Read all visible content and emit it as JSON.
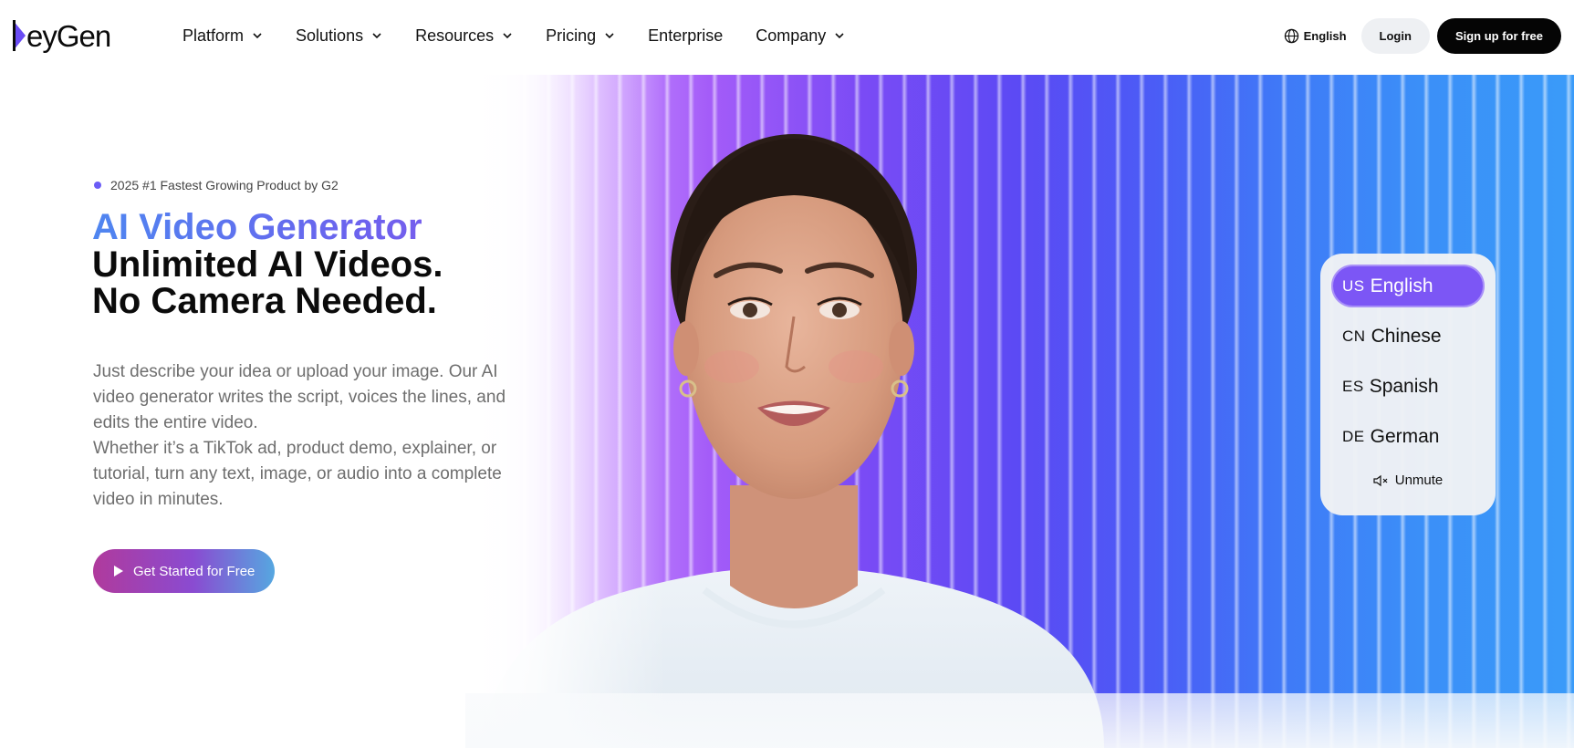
{
  "brand": {
    "logo_text": "HeyGen"
  },
  "nav": {
    "items": [
      {
        "label": "Platform",
        "has_dropdown": true
      },
      {
        "label": "Solutions",
        "has_dropdown": true
      },
      {
        "label": "Resources",
        "has_dropdown": true
      },
      {
        "label": "Pricing",
        "has_dropdown": true
      },
      {
        "label": "Enterprise",
        "has_dropdown": false
      },
      {
        "label": "Company",
        "has_dropdown": true
      }
    ],
    "language": "English",
    "login": "Login",
    "signup": "Sign up for free"
  },
  "hero": {
    "badge": "2025 #1 Fastest Growing Product by G2",
    "title_gradient": "AI Video Generator",
    "title_line1": "Unlimited AI Videos.",
    "title_line2": "No Camera Needed.",
    "description": "Just describe your idea or upload your image. Our AI video generator writes the script, voices the lines, and edits the entire video.",
    "description2": "Whether it’s a TikTok ad, product demo, explainer, or tutorial, turn any text, image, or audio into a complete video in minutes.",
    "cta": "Get Started for Free"
  },
  "language_card": {
    "options": [
      {
        "code": "US",
        "label": "English",
        "active": true
      },
      {
        "code": "CN",
        "label": "Chinese",
        "active": false
      },
      {
        "code": "ES",
        "label": "Spanish",
        "active": false
      },
      {
        "code": "DE",
        "label": "German",
        "active": false
      }
    ],
    "unmute": "Unmute"
  },
  "colors": {
    "accent_purple": "#7c56f5",
    "badge_dot": "#6b5cf6",
    "cta_gradient_start": "#b03a9c",
    "cta_gradient_end": "#56a7e0",
    "signup_bg": "#050505"
  },
  "icons": [
    "globe-icon",
    "chevron-down-icon",
    "play-icon",
    "mute-icon"
  ]
}
